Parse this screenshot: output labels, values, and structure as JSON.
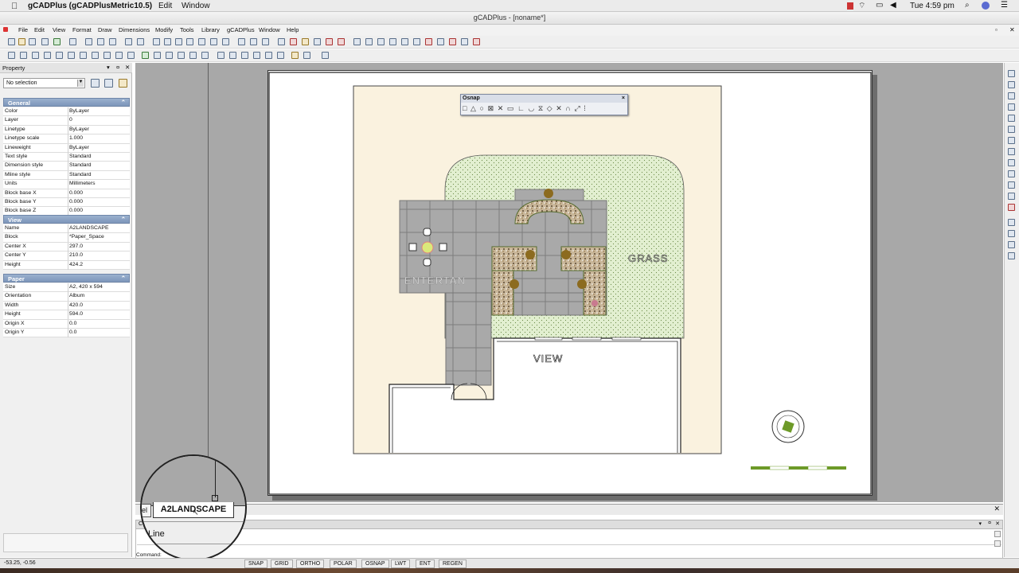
{
  "mac_menubar": {
    "apple": "",
    "app": "gCADPlus (gCADPlusMetric10.5)",
    "edit": "Edit",
    "window": "Window",
    "clock": "Tue 4:59 pm"
  },
  "window": {
    "title": "gCADPlus - [noname*]"
  },
  "menus": [
    "File",
    "Edit",
    "View",
    "Format",
    "Draw",
    "Dimensions",
    "Modify",
    "Tools",
    "Library",
    "gCADPlus",
    "Window",
    "Help"
  ],
  "property_panel": {
    "title": "Property",
    "selection": "No selection",
    "general": {
      "title": "General",
      "rows": [
        [
          "Color",
          "ByLayer"
        ],
        [
          "Layer",
          "0"
        ],
        [
          "Linetype",
          "ByLayer"
        ],
        [
          "Linetype scale",
          "1.000"
        ],
        [
          "Lineweight",
          "ByLayer"
        ],
        [
          "Text style",
          "Standard"
        ],
        [
          "Dimension style",
          "Standard"
        ],
        [
          "Mline style",
          "Standard"
        ],
        [
          "Units",
          "Millimeters"
        ],
        [
          "Block base X",
          "0.000"
        ],
        [
          "Block base Y",
          "0.000"
        ],
        [
          "Block base Z",
          "0.000"
        ]
      ]
    },
    "view": {
      "title": "View",
      "rows": [
        [
          "Name",
          "A2LANDSCAPE"
        ],
        [
          "Block",
          "*Paper_Space"
        ],
        [
          "Center X",
          "297.0"
        ],
        [
          "Center Y",
          "210.0"
        ],
        [
          "Height",
          "424.2"
        ]
      ]
    },
    "paper": {
      "title": "Paper",
      "rows": [
        [
          "Size",
          "A2,  420 x 594"
        ],
        [
          "Orientation",
          "Album"
        ],
        [
          "Width",
          "420.0"
        ],
        [
          "Height",
          "594.0"
        ],
        [
          "Origin X",
          "0.0"
        ],
        [
          "Origin Y",
          "0.0"
        ]
      ]
    }
  },
  "drawing": {
    "label_entertain": "ENTERTAN",
    "label_grass": "GRASS",
    "label_view": "VIEW"
  },
  "osnap": {
    "title": "Osnap",
    "close": "×"
  },
  "layout_tabs": {
    "left_tab": "el",
    "active_tab": "A2LANDSCAPE"
  },
  "command": {
    "last_line": "Line",
    "prompt": "Command:",
    "header_partial": "C"
  },
  "status": {
    "coords": "-53.25, -0.56",
    "buttons": [
      "SNAP",
      "GRID",
      "ORTHO",
      "POLAR",
      "OSNAP",
      "LWT",
      "ENT",
      "REGEN"
    ]
  },
  "colors": {
    "grass": "#e2efd0",
    "paving": "#a9a9a9",
    "sand": "#faf2df",
    "scale_bar": "#6d9a28"
  }
}
